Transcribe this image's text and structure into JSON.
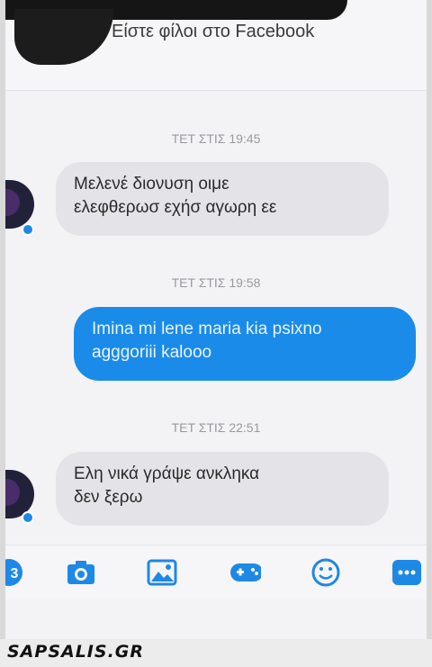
{
  "header": {
    "text": "Είστε φίλοι στο Facebook"
  },
  "messages": [
    {
      "timestamp": "ΤΕΤ ΣΤΙΣ 19:45",
      "direction": "incoming",
      "lines": [
        "Μελενέ διονυση οιμε",
        "ελεφθερωσ εχήσ αγωρη εε"
      ]
    },
    {
      "timestamp": "ΤΕΤ ΣΤΙΣ 19:58",
      "direction": "outgoing",
      "lines": [
        "Imina mi lene maria kia psixno",
        "agggoriii kalooo"
      ]
    },
    {
      "timestamp": "ΤΕΤ ΣΤΙΣ 22:51",
      "direction": "incoming",
      "lines": [
        "Ελη νικά γράψε ανκληκα",
        "δεν ξερω"
      ]
    }
  ],
  "toolbar": {
    "icons": [
      "partial-icon",
      "camera-icon",
      "gallery-icon",
      "game-icon",
      "emoji-icon",
      "more-icon"
    ]
  },
  "watermark": {
    "text": "SAPSALIS.GR"
  },
  "colors": {
    "outgoing_bubble": "#1b8bea",
    "incoming_bubble": "#e4e4e8",
    "toolbar_icon": "#1e88e5"
  }
}
